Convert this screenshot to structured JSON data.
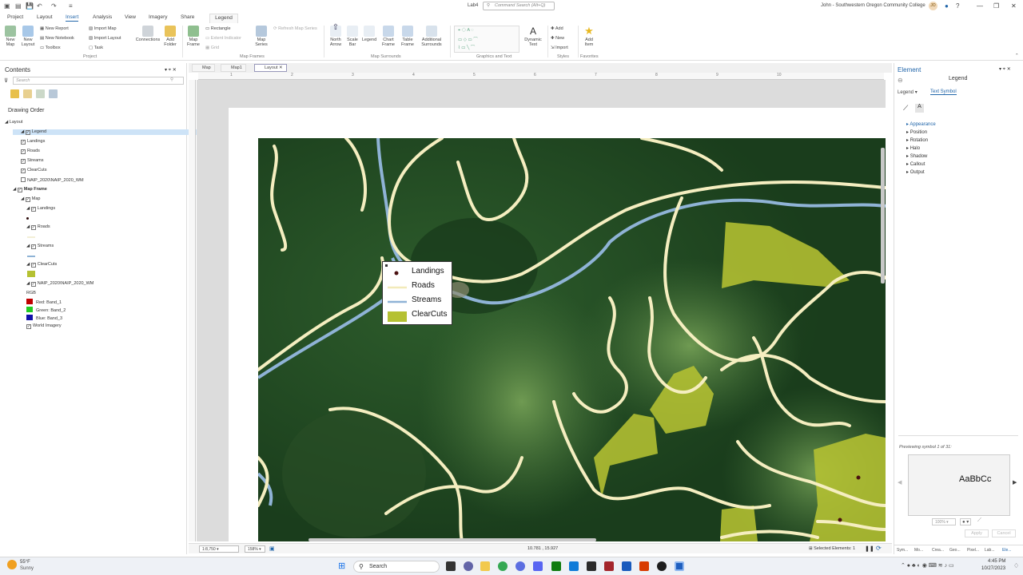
{
  "titlebar": {
    "project_name": "Lab4",
    "command_search_placeholder": "Command Search (Alt+Q)",
    "user_org": "John - Southwestern Oregon Community College",
    "avatar_initials": "JO"
  },
  "ribbon_tabs": [
    "Project",
    "Layout",
    "Insert",
    "Analysis",
    "View",
    "Imagery",
    "Share"
  ],
  "active_tab": "Insert",
  "contextual_tab": "Legend",
  "ribbon": {
    "project_group": {
      "new_map": "New Map",
      "new_layout": "New Layout",
      "new_report": "New Report",
      "new_notebook": "New Notebook",
      "toolbox": "Toolbox",
      "import_map": "Import Map",
      "import_layout": "Import Layout",
      "task": "Task",
      "connections": "Connections",
      "add_folder": "Add Folder",
      "label": "Project"
    },
    "map_frames_group": {
      "map_frame": "Map Frame",
      "rectangle": "Rectangle",
      "extent_indicator": "Extent Indicator",
      "grid": "Grid",
      "map_series": "Map Series",
      "refresh_map_series": "Refresh Map Series",
      "label": "Map Frames"
    },
    "map_surrounds_group": {
      "north_arrow": "North Arrow",
      "scale_bar": "Scale Bar",
      "legend": "Legend",
      "chart_frame": "Chart Frame",
      "table_frame": "Table Frame",
      "additional_surrounds": "Additional Surrounds",
      "label": "Map Surrounds"
    },
    "graphics_group": {
      "dynamic_text": "Dynamic Text",
      "label": "Graphics and Text"
    },
    "styles_group": {
      "add": "Add",
      "new": "New",
      "import": "Import",
      "label": "Styles"
    },
    "favorites_group": {
      "add_item": "Add Item",
      "label": "Favorites"
    }
  },
  "contents": {
    "title": "Contents",
    "search_placeholder": "Search",
    "drawing_order": "Drawing Order",
    "tree": [
      {
        "label": "Layout",
        "level": 0
      },
      {
        "label": "Legend",
        "level": 1,
        "selected": true
      },
      {
        "label": "Landings",
        "level": 2
      },
      {
        "label": "Roads",
        "level": 2
      },
      {
        "label": "Streams",
        "level": 2
      },
      {
        "label": "ClearCuts",
        "level": 2
      },
      {
        "label": "NAIP_2020\\NAIP_2020_WM",
        "level": 2
      },
      {
        "label": "Map Frame",
        "level": 1,
        "bold": true
      },
      {
        "label": "Map",
        "level": 2
      },
      {
        "label": "Landings",
        "level": 3
      },
      {
        "label": "Roads",
        "level": 3
      },
      {
        "label": "Streams",
        "level": 3
      },
      {
        "label": "ClearCuts",
        "level": 3
      },
      {
        "label": "NAIP_2020\\NAIP_2020_WM",
        "level": 3
      },
      {
        "label": "RGB",
        "level": 4
      },
      {
        "label": "Red:  Band_1",
        "level": 4
      },
      {
        "label": "Green: Band_2",
        "level": 4
      },
      {
        "label": "Blue:  Band_3",
        "level": 4
      },
      {
        "label": "World Imagery",
        "level": 3
      }
    ]
  },
  "view_tabs": [
    "Map",
    "Map1",
    "Layout"
  ],
  "active_view": "Layout",
  "ruler_ticks": [
    "1",
    "2",
    "3",
    "4",
    "5",
    "6",
    "7",
    "8",
    "9",
    "10"
  ],
  "legend": {
    "items": [
      {
        "label": "Landings",
        "symbol": "point",
        "color": "#4a1010"
      },
      {
        "label": "Roads",
        "symbol": "line",
        "color": "#f5eec0"
      },
      {
        "label": "Streams",
        "symbol": "line",
        "color": "#8fb3d6"
      },
      {
        "label": "ClearCuts",
        "symbol": "fill",
        "color": "#b5c132"
      }
    ]
  },
  "status": {
    "scale": "1:8,750",
    "zoom": "158%",
    "coordinates": "10.781 , 15.927",
    "selected_elements": "Selected Elements: 1"
  },
  "element_pane": {
    "title": "Element",
    "subtitle": "Legend",
    "dropdown_value": "Legend",
    "text_symbol_link": "Text Symbol",
    "sections": [
      "Appearance",
      "Position",
      "Rotation",
      "Halo",
      "Shadow",
      "Callout",
      "Output"
    ],
    "preview_caption": "Previewing symbol 1 of 31:",
    "preview_text": "AaBbCc",
    "preview_zoom": "100%",
    "apply": "Apply",
    "cancel": "Cancel",
    "bottom_tabs": [
      "Sym...",
      "Mo...",
      "Crea...",
      "Geo...",
      "Pixel...",
      "Lab...",
      "Ele..."
    ]
  },
  "taskbar": {
    "weather_temp": "55°F",
    "weather_desc": "Sunny",
    "search_label": "Search",
    "time": "4:45 PM",
    "date": "10/27/2023"
  },
  "colors": {
    "accent": "#2266aa",
    "selection": "#cde3f7",
    "clearcuts": "#b5c132",
    "streams": "#8fb3d6",
    "roads": "#f5eec0",
    "forest": "#1f4a22"
  }
}
